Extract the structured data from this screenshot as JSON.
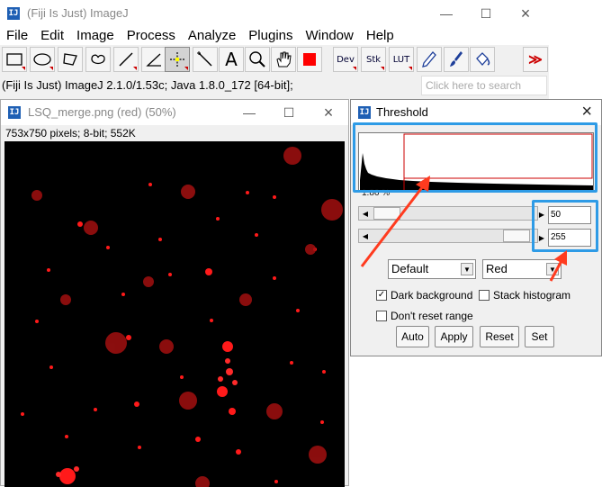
{
  "main_window": {
    "icon_text": "IJ",
    "title": "(Fiji Is Just) ImageJ",
    "menu": [
      "File",
      "Edit",
      "Image",
      "Process",
      "Analyze",
      "Plugins",
      "Window",
      "Help"
    ],
    "toolbar": [
      {
        "name": "rectangle-tool",
        "label": ""
      },
      {
        "name": "oval-tool",
        "label": ""
      },
      {
        "name": "polygon-tool",
        "label": ""
      },
      {
        "name": "freehand-tool",
        "label": ""
      },
      {
        "name": "line-tool",
        "label": ""
      },
      {
        "name": "angle-tool",
        "label": ""
      },
      {
        "name": "multipoint-tool",
        "label": ""
      },
      {
        "name": "wand-tool",
        "label": ""
      },
      {
        "name": "text-tool",
        "label": "A"
      },
      {
        "name": "magnifier-tool",
        "label": ""
      },
      {
        "name": "hand-tool",
        "label": ""
      },
      {
        "name": "color-picker-tool",
        "label": ""
      },
      {
        "name": "dev-tool",
        "label": "Dev"
      },
      {
        "name": "stk-tool",
        "label": "Stk"
      },
      {
        "name": "lut-tool",
        "label": "LUT"
      },
      {
        "name": "pencil-tool",
        "label": ""
      },
      {
        "name": "brush-tool",
        "label": ""
      },
      {
        "name": "flood-fill-tool",
        "label": ""
      },
      {
        "name": "more-tools",
        "label": "≫"
      }
    ],
    "status": "(Fiji Is Just) ImageJ 2.1.0/1.53c; Java 1.8.0_172 [64-bit];",
    "search_placeholder": "Click here to search"
  },
  "image_window": {
    "title": "LSQ_merge.png (red) (50%)",
    "info": "753x750 pixels; 8-bit; 552K"
  },
  "threshold_dialog": {
    "title": "Threshold",
    "percent": "1.86 %",
    "lower_value": "50",
    "upper_value": "255",
    "method": "Default",
    "display_mode": "Red",
    "dark_background_label": "Dark background",
    "dark_background_checked": true,
    "stack_histogram_label": "Stack histogram",
    "stack_histogram_checked": false,
    "dont_reset_label": "Don't reset range",
    "dont_reset_checked": false,
    "buttons": [
      "Auto",
      "Apply",
      "Reset",
      "Set"
    ]
  },
  "colors": {
    "accent_highlight": "#2e9be6",
    "annotation_arrow": "#ff3b1f",
    "threshold_red": "#ff0000"
  }
}
